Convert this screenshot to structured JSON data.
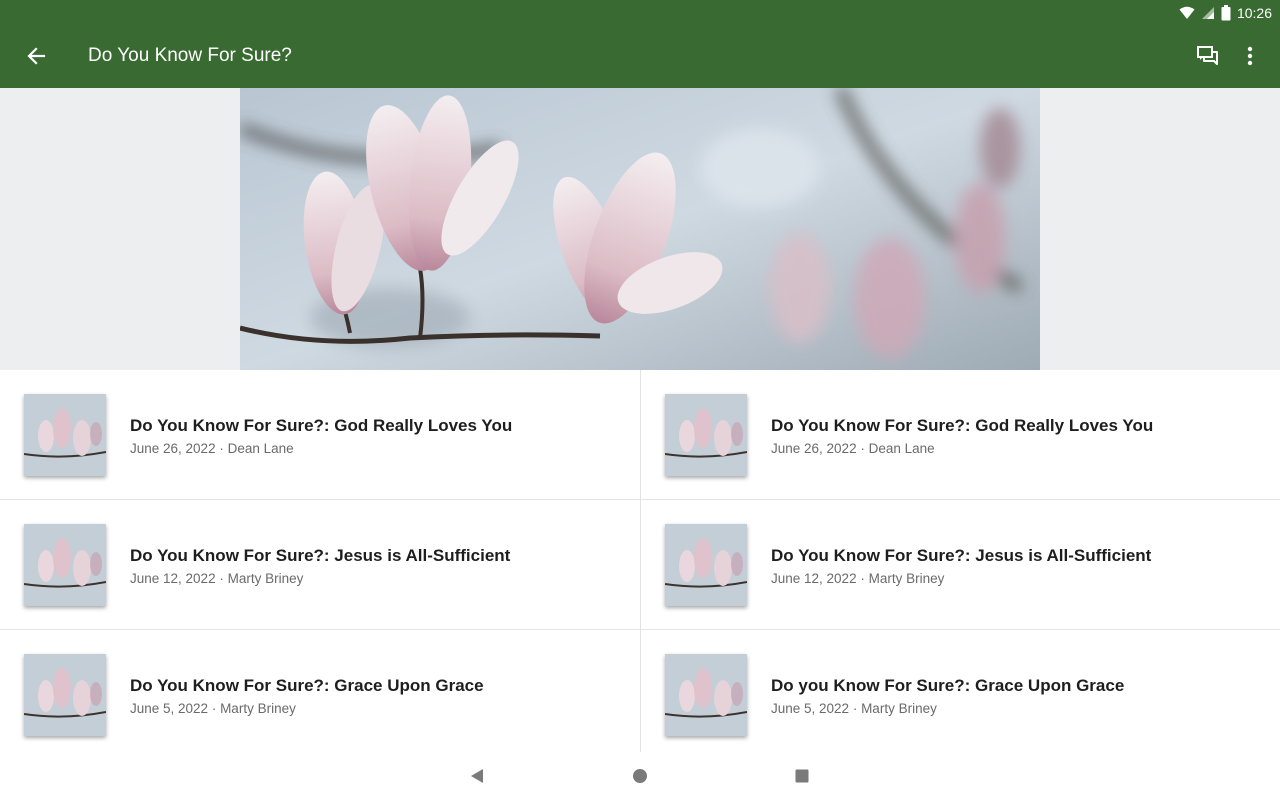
{
  "status_bar": {
    "time": "10:26",
    "icons": [
      "wifi-icon",
      "signal-icon",
      "battery-icon"
    ]
  },
  "app_bar": {
    "title": "Do You Know For Sure?",
    "back_icon": "arrow-back-icon",
    "actions": [
      "chat-icon",
      "more-vert-icon"
    ],
    "color": "#386a32"
  },
  "hero": {
    "image": "magnolia-blossoms-photo"
  },
  "sermons_left": [
    {
      "title": "Do You Know For Sure?: God Really Loves You",
      "subtitle": "June 26, 2022 · Dean Lane"
    },
    {
      "title": "Do You Know For Sure?: Jesus is All-Sufficient",
      "subtitle": "June 12, 2022 · Marty Briney"
    },
    {
      "title": "Do You Know For Sure?: Grace Upon Grace",
      "subtitle": "June 5, 2022 · Marty Briney"
    }
  ],
  "sermons_right": [
    {
      "title": "Do You Know For Sure?: God Really Loves You",
      "subtitle": "June 26, 2022 · Dean Lane"
    },
    {
      "title": "Do You Know For Sure?: Jesus is All-Sufficient",
      "subtitle": "June 12, 2022 · Marty Briney"
    },
    {
      "title": "Do you Know For Sure?: Grace Upon Grace",
      "subtitle": "June 5, 2022 · Marty Briney"
    }
  ],
  "nav_bar": {
    "buttons": [
      "back-triangle-icon",
      "home-circle-icon",
      "recents-square-icon"
    ]
  }
}
